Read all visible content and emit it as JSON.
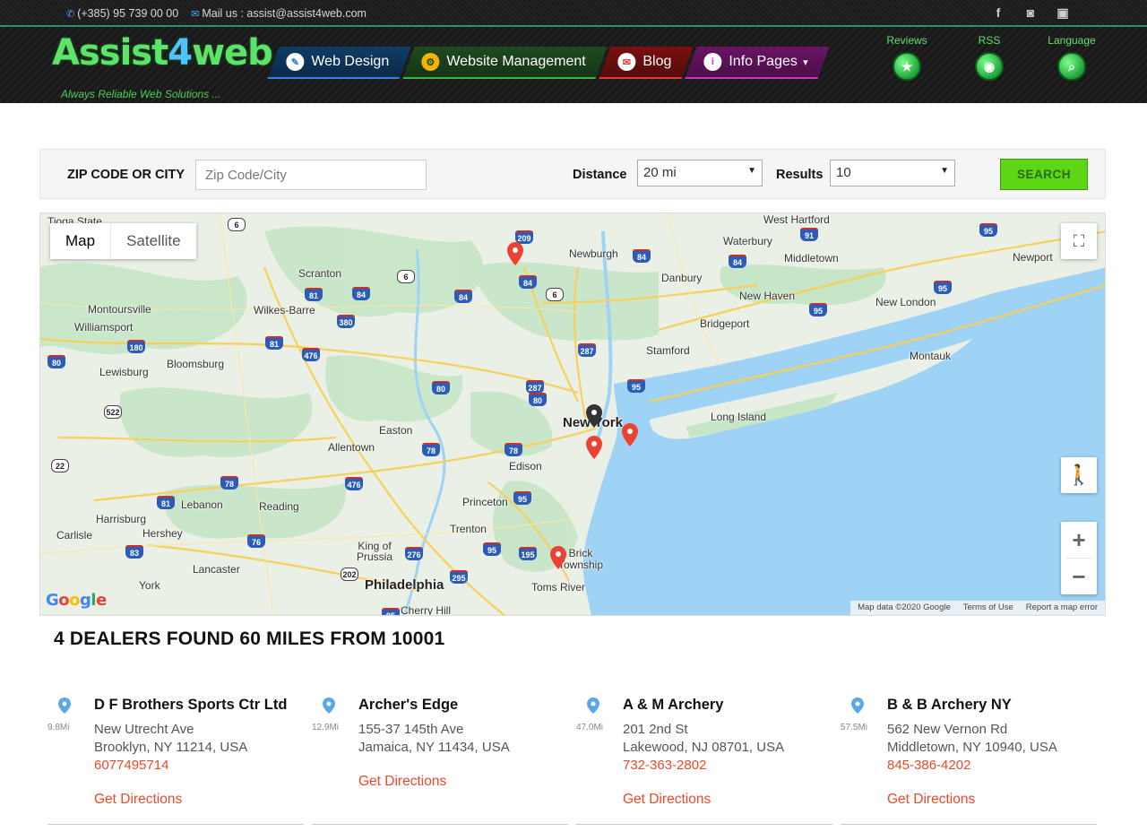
{
  "topbar": {
    "phone": "(+385) 95 739 00 00",
    "mail": "Mail us : assist@assist4web.com",
    "social": [
      "facebook-icon",
      "instagram-icon",
      "youtube-icon"
    ]
  },
  "header": {
    "logo_main": "ssist",
    "logo_four": "4",
    "logo_web": "web",
    "tagline": "Always Reliable Web Solutions ...",
    "nav": [
      {
        "label": "Web Design",
        "icon": "pen-icon",
        "color": "#2f86d8"
      },
      {
        "label": "Website Management",
        "icon": "gear-icon",
        "color": "#39b54a"
      },
      {
        "label": "Blog",
        "icon": "blog-icon",
        "color": "#e53935"
      },
      {
        "label": "Info Pages",
        "icon": "info-icon",
        "color": "#c839c2",
        "caret": "▾"
      }
    ],
    "icons": [
      {
        "label": "Reviews",
        "glyph": "★"
      },
      {
        "label": "RSS",
        "glyph": "◉"
      },
      {
        "label": "Language",
        "glyph": "⌕"
      }
    ]
  },
  "search": {
    "zip_label": "ZIP CODE OR CITY",
    "zip_placeholder": "Zip Code/City",
    "distance_label": "Distance",
    "distance_value": "20 mi",
    "results_label": "Results",
    "results_value": "10",
    "button": "SEARCH",
    "accent": "#5cd615"
  },
  "map": {
    "type_map": "Map",
    "type_satellite": "Satellite",
    "attribution": [
      "Map data ©2020 Google",
      "Terms of Use",
      "Report a map error"
    ],
    "google": "Google",
    "places": [
      "Scranton",
      "Wilkes-Barre",
      "Montoursville",
      "Williamsport",
      "Bloomsburg",
      "Lewisburg",
      "Newburgh",
      "Danbury",
      "Waterbury",
      "Middletown",
      "West Hartford",
      "New Haven",
      "Bridgeport",
      "Stamford",
      "New London",
      "Newport",
      "Montauk",
      "Long Island",
      "New York",
      "Allentown",
      "Easton",
      "Edison",
      "Princeton",
      "Trenton",
      "Reading",
      "Lebanon",
      "Harrisburg",
      "Hershey",
      "Carlisle",
      "Lancaster",
      "York",
      "King of Prussia",
      "Philadelphia",
      "Cherry Hill",
      "Brick Township",
      "Toms River",
      "Tioga State"
    ],
    "zoom_in": "+",
    "zoom_out": "−"
  },
  "results": {
    "summary": "4 DEALERS FOUND 60 MILES FROM 10001",
    "directions_label": "Get Directions",
    "dealers": [
      {
        "name": "D F Brothers Sports Ctr Ltd",
        "distance": "9.8Mi",
        "street": "New Utrecht Ave",
        "city": "Brooklyn, NY 11214, USA",
        "phone": "6077495714"
      },
      {
        "name": "Archer's Edge",
        "distance": "12.9Mi",
        "street": "155-37 145th Ave",
        "city": "Jamaica, NY 11434, USA",
        "phone": ""
      },
      {
        "name": "A & M Archery",
        "distance": "47.0Mi",
        "street": "201 2nd St",
        "city": "Lakewood, NJ 08701, USA",
        "phone": "732-363-2802"
      },
      {
        "name": "B & B Archery NY",
        "distance": "57.5Mi",
        "street": "562 New Vernon Rd",
        "city": "Middletown, NY 10940, USA",
        "phone": "845-386-4202"
      }
    ]
  }
}
